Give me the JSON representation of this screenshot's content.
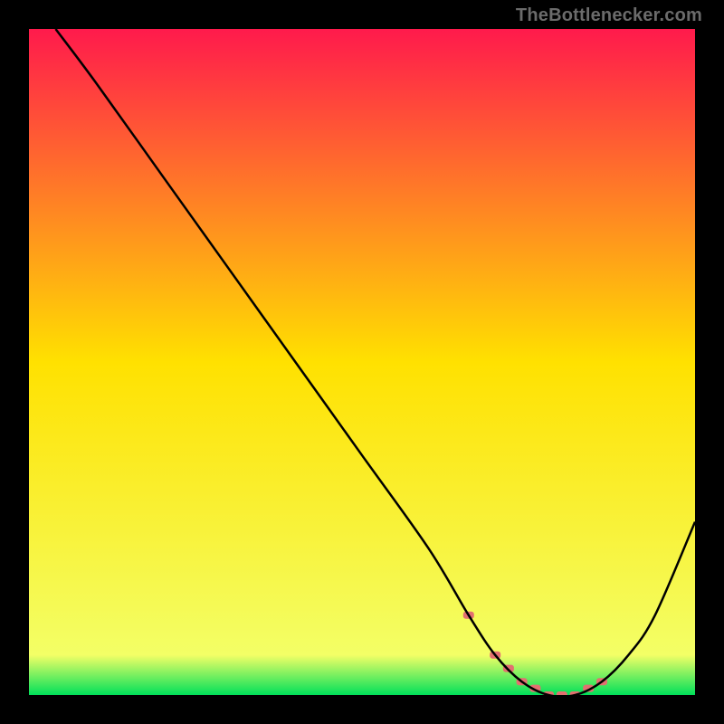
{
  "attribution": "TheBottleneсker.com",
  "chart_data": {
    "type": "line",
    "title": "",
    "xlabel": "",
    "ylabel": "",
    "xlim": [
      0,
      100
    ],
    "ylim": [
      0,
      100
    ],
    "grid": false,
    "background_gradient_top": "#ff1a4c",
    "background_gradient_mid": "#ffe100",
    "background_gradient_bottom": "#00e05a",
    "series": [
      {
        "name": "bottleneck-curve",
        "stroke": "#000000",
        "x": [
          4,
          10,
          20,
          30,
          40,
          50,
          60,
          66,
          70,
          74,
          78,
          82,
          86,
          90,
          94,
          100
        ],
        "y": [
          100,
          92,
          78,
          64,
          50,
          36,
          22,
          12,
          6,
          2,
          0,
          0,
          2,
          6,
          12,
          26
        ]
      }
    ],
    "markers": {
      "name": "highlight-band",
      "color": "#e27070",
      "x": [
        66,
        70,
        72,
        74,
        76,
        78,
        80,
        82,
        84,
        86
      ],
      "y": [
        12,
        6,
        4,
        2,
        1,
        0,
        0,
        0,
        1,
        2
      ]
    }
  }
}
